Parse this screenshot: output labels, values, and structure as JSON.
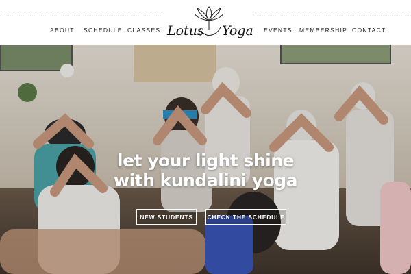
{
  "nav": {
    "left": [
      "ABOUT",
      "SCHEDULE",
      "CLASSES"
    ],
    "right": [
      "EVENTS",
      "MEMBERSHIP",
      "CONTACT"
    ]
  },
  "logo": {
    "word1": "Lotus",
    "word2": "Yoga"
  },
  "hero": {
    "headline_line1": "let your light shine",
    "headline_line2": "with kundalini yoga",
    "button_new_students": "NEW STUDENTS",
    "button_schedule": "CHECK THE SCHEDULE"
  },
  "colors": {
    "text": "#222222",
    "white": "#ffffff"
  }
}
